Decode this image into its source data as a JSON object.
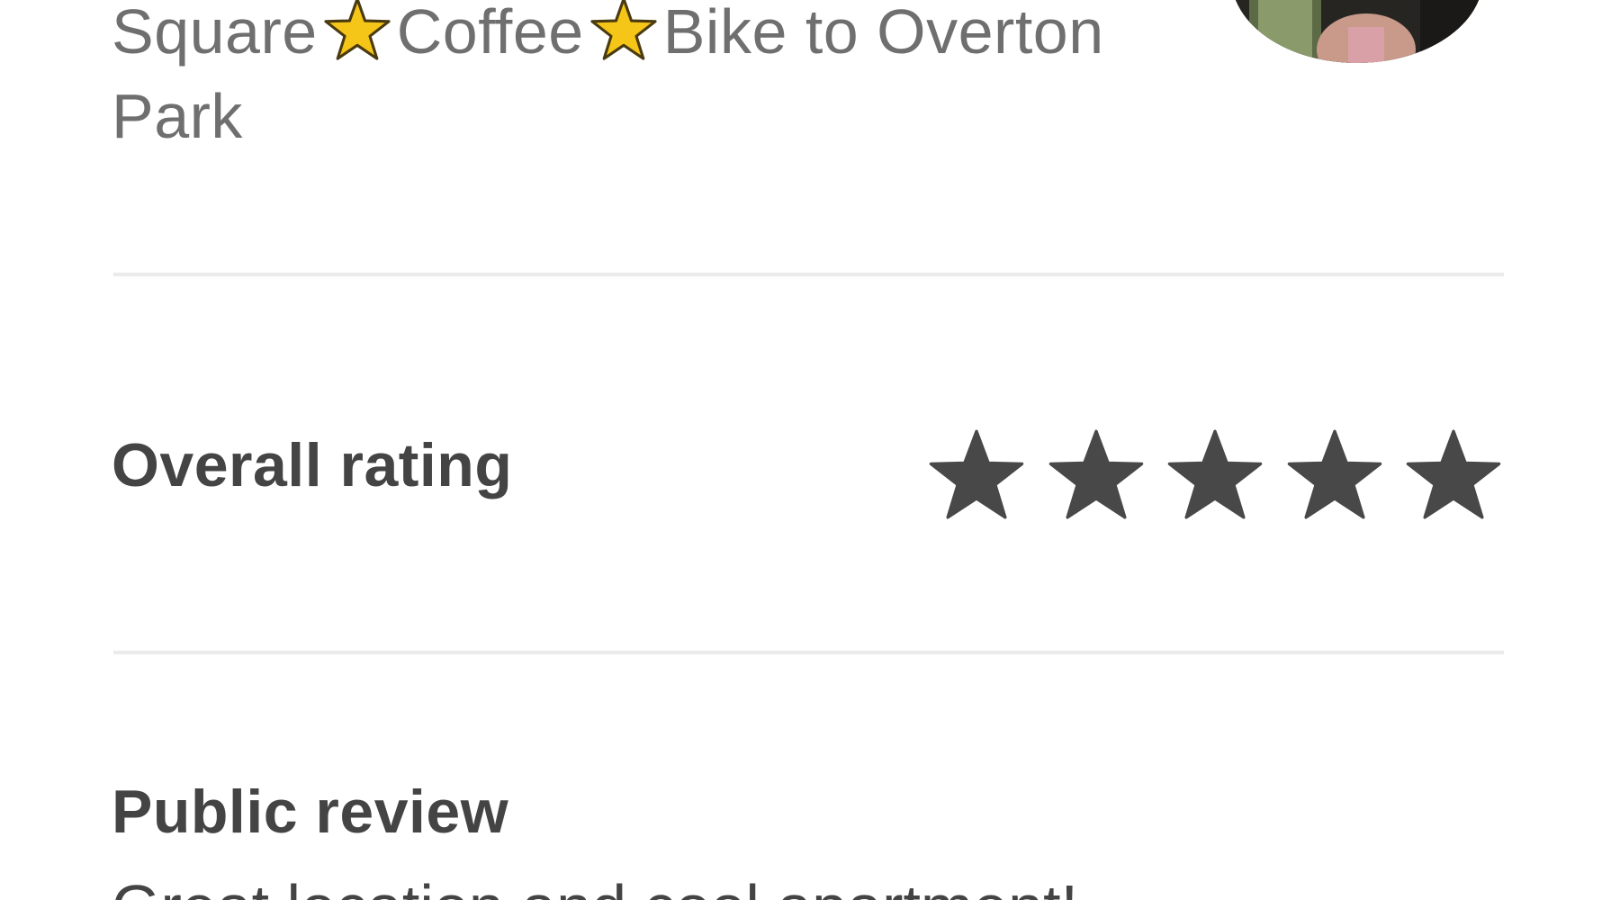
{
  "listing": {
    "title_parts": [
      "Square",
      "Coffee",
      "Bike to Overton Park"
    ]
  },
  "icons": {
    "inline_star": "star-emoji-icon",
    "rating_star": "star-icon"
  },
  "colors": {
    "title_text": "#6f6f6f",
    "label_text": "#444444",
    "divider": "#ebebeb",
    "inline_star_fill": "#f5c518",
    "rating_star_fill": "#484848"
  },
  "overall_rating": {
    "label": "Overall rating",
    "value": 5,
    "max": 5
  },
  "public_review": {
    "label": "Public review",
    "preview_text": "Great location and cool apartment!"
  }
}
